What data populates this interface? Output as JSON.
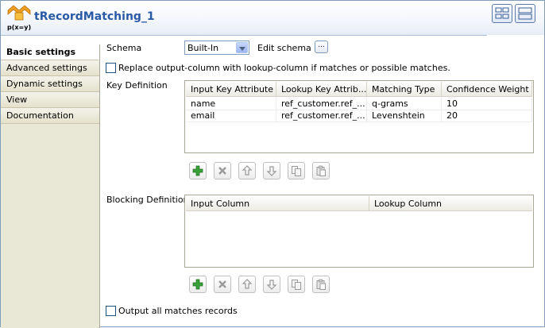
{
  "component": {
    "title": "tRecordMatching_1",
    "icon_text": "p(x=y)"
  },
  "tabs": [
    {
      "label": "Basic settings",
      "active": true
    },
    {
      "label": "Advanced settings",
      "active": false
    },
    {
      "label": "Dynamic settings",
      "active": false
    },
    {
      "label": "View",
      "active": false
    },
    {
      "label": "Documentation",
      "active": false
    }
  ],
  "schema": {
    "label": "Schema",
    "value": "Built-In",
    "edit_label": "Edit schema",
    "edit_button": "..."
  },
  "replace_option": {
    "label": "Replace output-column with lookup-column if matches or possible matches.",
    "checked": false
  },
  "key_definition": {
    "label": "Key Definition",
    "columns": [
      "Input Key Attribute",
      "Lookup Key Attrib...",
      "Matching Type",
      "Confidence Weight"
    ],
    "rows": [
      [
        "name",
        "ref_customer.ref_...",
        "q-grams",
        "10"
      ],
      [
        "email",
        "ref_customer.ref_...",
        "Levenshtein",
        "20"
      ]
    ]
  },
  "blocking_definition": {
    "label": "Blocking Definition",
    "columns": [
      "Input Column",
      "Lookup Column"
    ],
    "rows": []
  },
  "toolbar_icons": [
    "add-icon",
    "delete-icon",
    "move-up-icon",
    "move-down-icon",
    "copy-icon",
    "paste-icon"
  ],
  "output_all": {
    "label": "Output all matches records",
    "checked": false
  },
  "colors": {
    "title": "#2a5aa6",
    "add_icon": "#3aa13a"
  }
}
